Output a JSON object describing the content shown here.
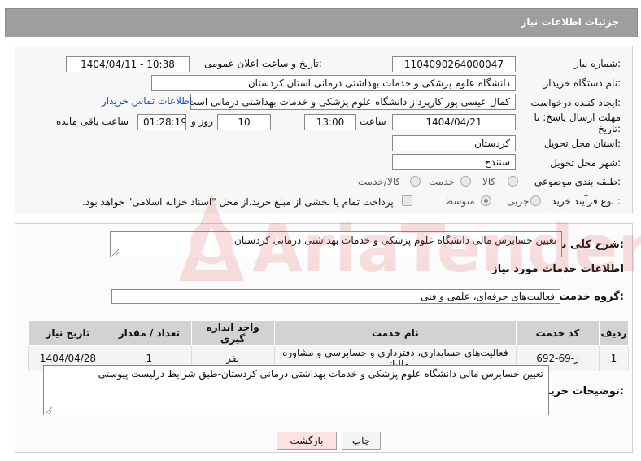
{
  "header": {
    "title": "جزئیات اطلاعات نیاز"
  },
  "form": {
    "need_number_label": "شماره نیاز:",
    "need_number": "1104090264000047",
    "announce_label": "تاریخ و ساعت اعلان عمومی:",
    "announce_value": "1404/04/11 - 10:38",
    "buyer_org_label": "نام دستگاه خریدار:",
    "buyer_org": "دانشگاه علوم پزشکی و خدمات بهداشتی  درمانی استان کردستان",
    "creator_label": "ایجاد کننده درخواست:",
    "creator": "کمال عیسی پور کارپرداز دانشگاه علوم پزشکی و خدمات بهداشتی  درمانی است",
    "contact_link": "اطلاعات تماس خریدار",
    "deadline_label_1": "مهلت ارسال پاسخ: تا",
    "deadline_label_2": "تاریخ:",
    "deadline_date": "1404/04/21",
    "time_label": "ساعت",
    "deadline_time": "13:00",
    "days_value": "10",
    "days_label": "روز و",
    "remaining_time": "01:28:19",
    "remaining_label": "ساعت باقی مانده",
    "province_label": "استان محل تحویل:",
    "province": "کردستان",
    "city_label": "شهر محل تحویل:",
    "city": "سنندج",
    "category_label": "طبقه بندی موضوعی:",
    "category_options": [
      "کالا",
      "خدمت",
      "کالا/خدمت"
    ],
    "process_label": "نوع فرآیند خرید :",
    "process_options": [
      "جزیی",
      "متوسط"
    ],
    "payment_note": "پرداخت تمام یا بخشی از مبلغ خرید،از محل \"اسناد خزانه اسلامی\" خواهد بود."
  },
  "details": {
    "summary_label": "شرح کلی نیاز:",
    "summary": "تعیین حسابرس مالی دانشگاه علوم پزشکی و خدمات بهداشتی درمانی کردستان",
    "services_heading": "اطلاعات خدمات مورد نیاز",
    "service_group_label": "گروه خدمت:",
    "service_group": "فعالیت‌های حرفه‌ای، علمی و فنی",
    "table": {
      "headers": [
        "ردیف",
        "کد خدمت",
        "نام خدمت",
        "واحد اندازه گیری",
        "تعداد / مقدار",
        "تاریخ نیاز"
      ],
      "rows": [
        [
          "1",
          "ز-69-692",
          "فعالیت‌های حسابداری، دفترداری و حسابرسی و مشاوره مالیاتی",
          "نفر",
          "1",
          "1404/04/28"
        ]
      ]
    },
    "buyer_notes_label": "توضیحات خریدار:",
    "buyer_notes": "تعیین حسابرس مالی دانشگاه علوم پزشکی و خدمات بهداشتی درمانی کردستان-طبق شرایط درلیست پیوستی"
  },
  "buttons": {
    "print": "چاپ",
    "back": "بازگشت"
  },
  "watermark": {
    "text": "AriaTender.neT"
  },
  "colors": {
    "header_bg": "#9e9e9e",
    "link": "#1b4fa8",
    "back_button_bg": "#fde2e2",
    "watermark": "#d9534f"
  }
}
